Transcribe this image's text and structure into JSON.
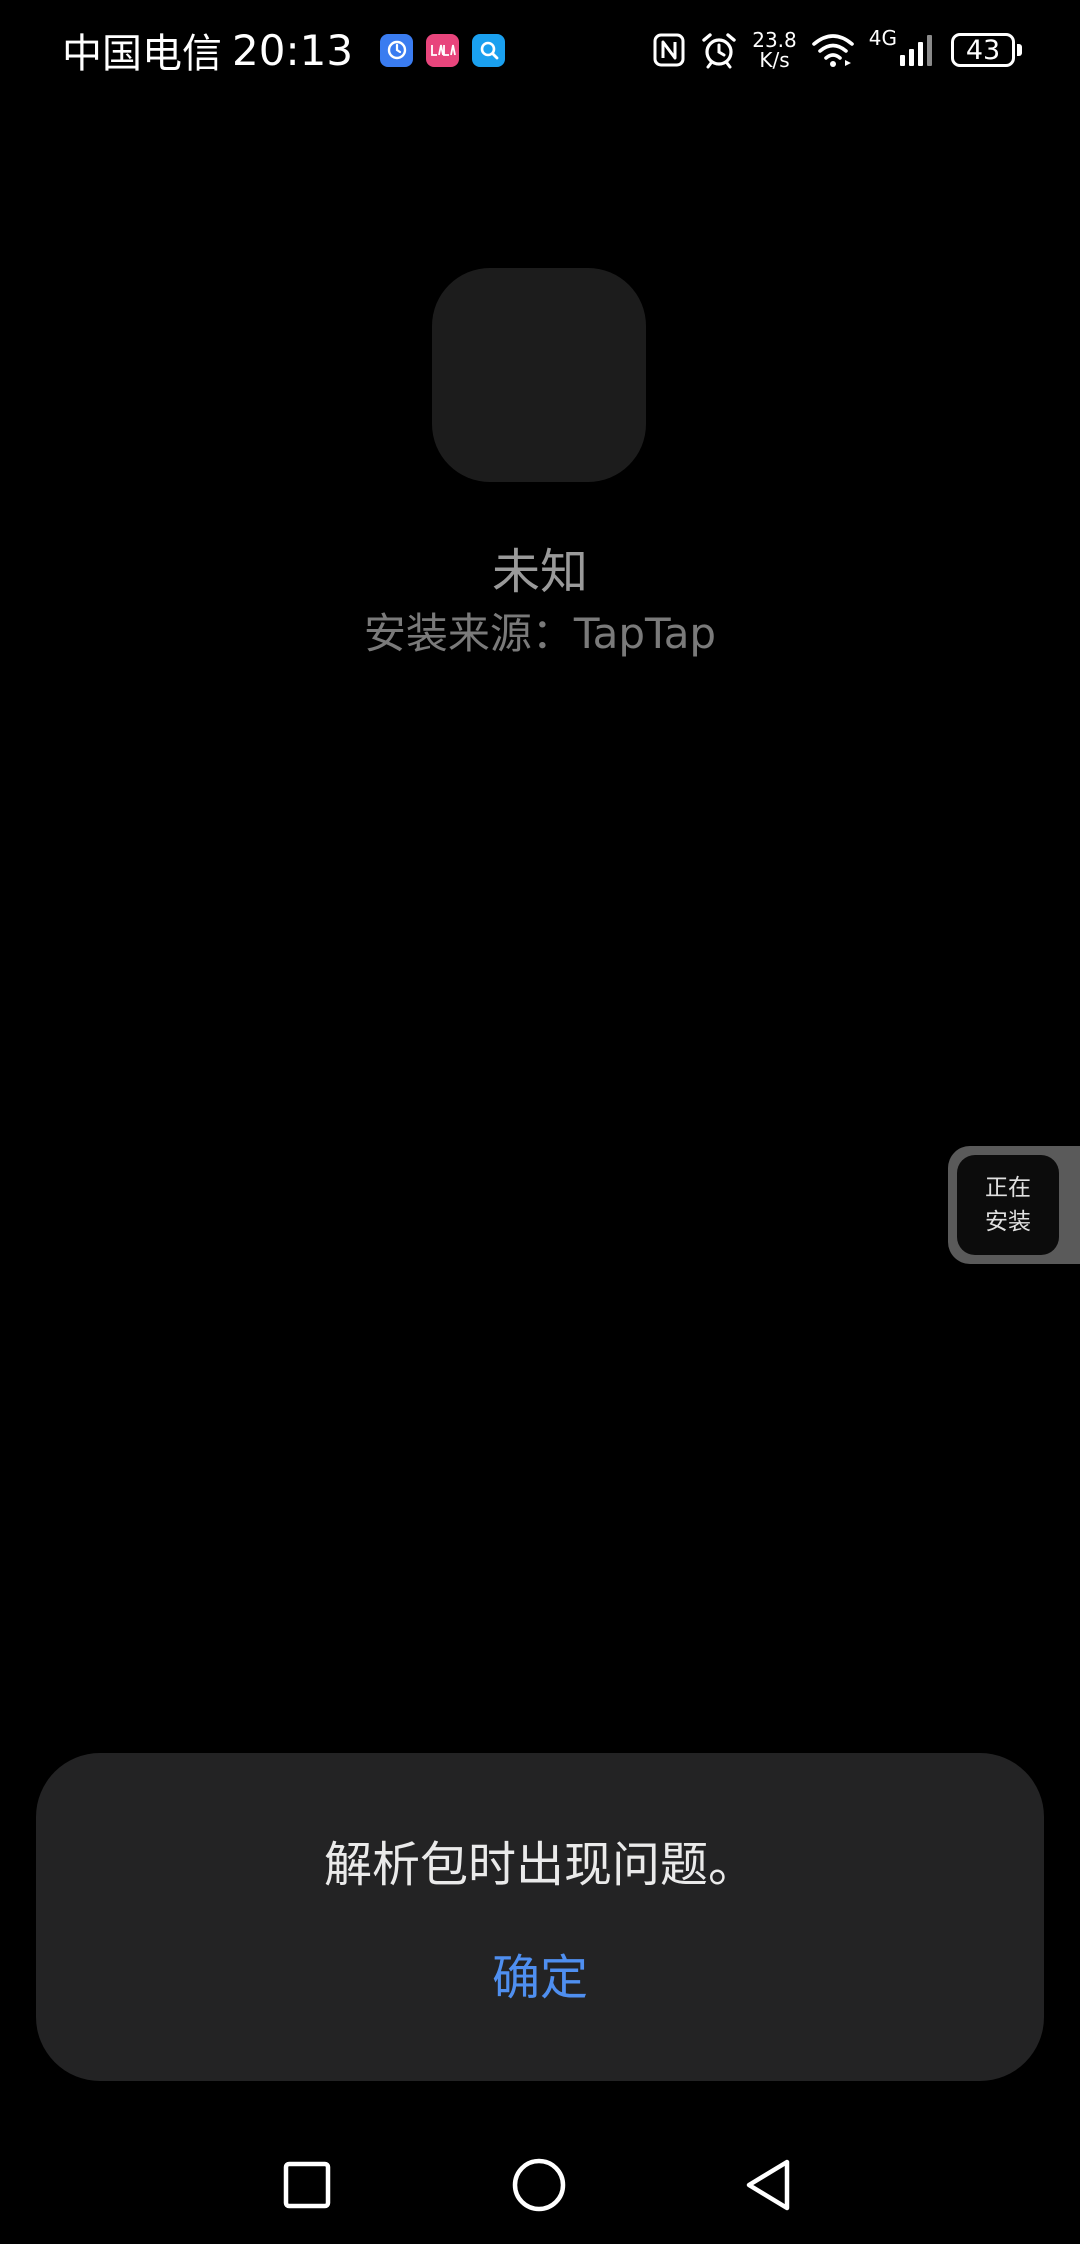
{
  "status_bar": {
    "carrier": "中国电信",
    "time": "20:13",
    "notification_icons": [
      "clock-app-icon",
      "lofter-app-icon",
      "search-app-icon"
    ],
    "nfc_icon": "nfc-icon",
    "alarm_icon": "alarm-icon",
    "net_speed_value": "23.8",
    "net_speed_unit": "K/s",
    "wifi_icon": "wifi-icon",
    "network_type": "4G",
    "signal_icon": "signal-icon",
    "battery_level": "43"
  },
  "app": {
    "name": "未知",
    "install_source": "安装来源：TapTap"
  },
  "floating_status": {
    "line1": "正在",
    "line2": "安装"
  },
  "dialog": {
    "message": "解析包时出现问题。",
    "confirm_label": "确定"
  },
  "nav_bar": {
    "recents_icon": "square-recents-icon",
    "home_icon": "circle-home-icon",
    "back_icon": "triangle-back-icon"
  },
  "colors": {
    "background": "#000000",
    "dialog_background": "#232324",
    "accent": "#4f8ff0",
    "clock_app": "#3a7cf0",
    "lofter_app": "#e8457c",
    "search_app": "#1aa0ef"
  }
}
